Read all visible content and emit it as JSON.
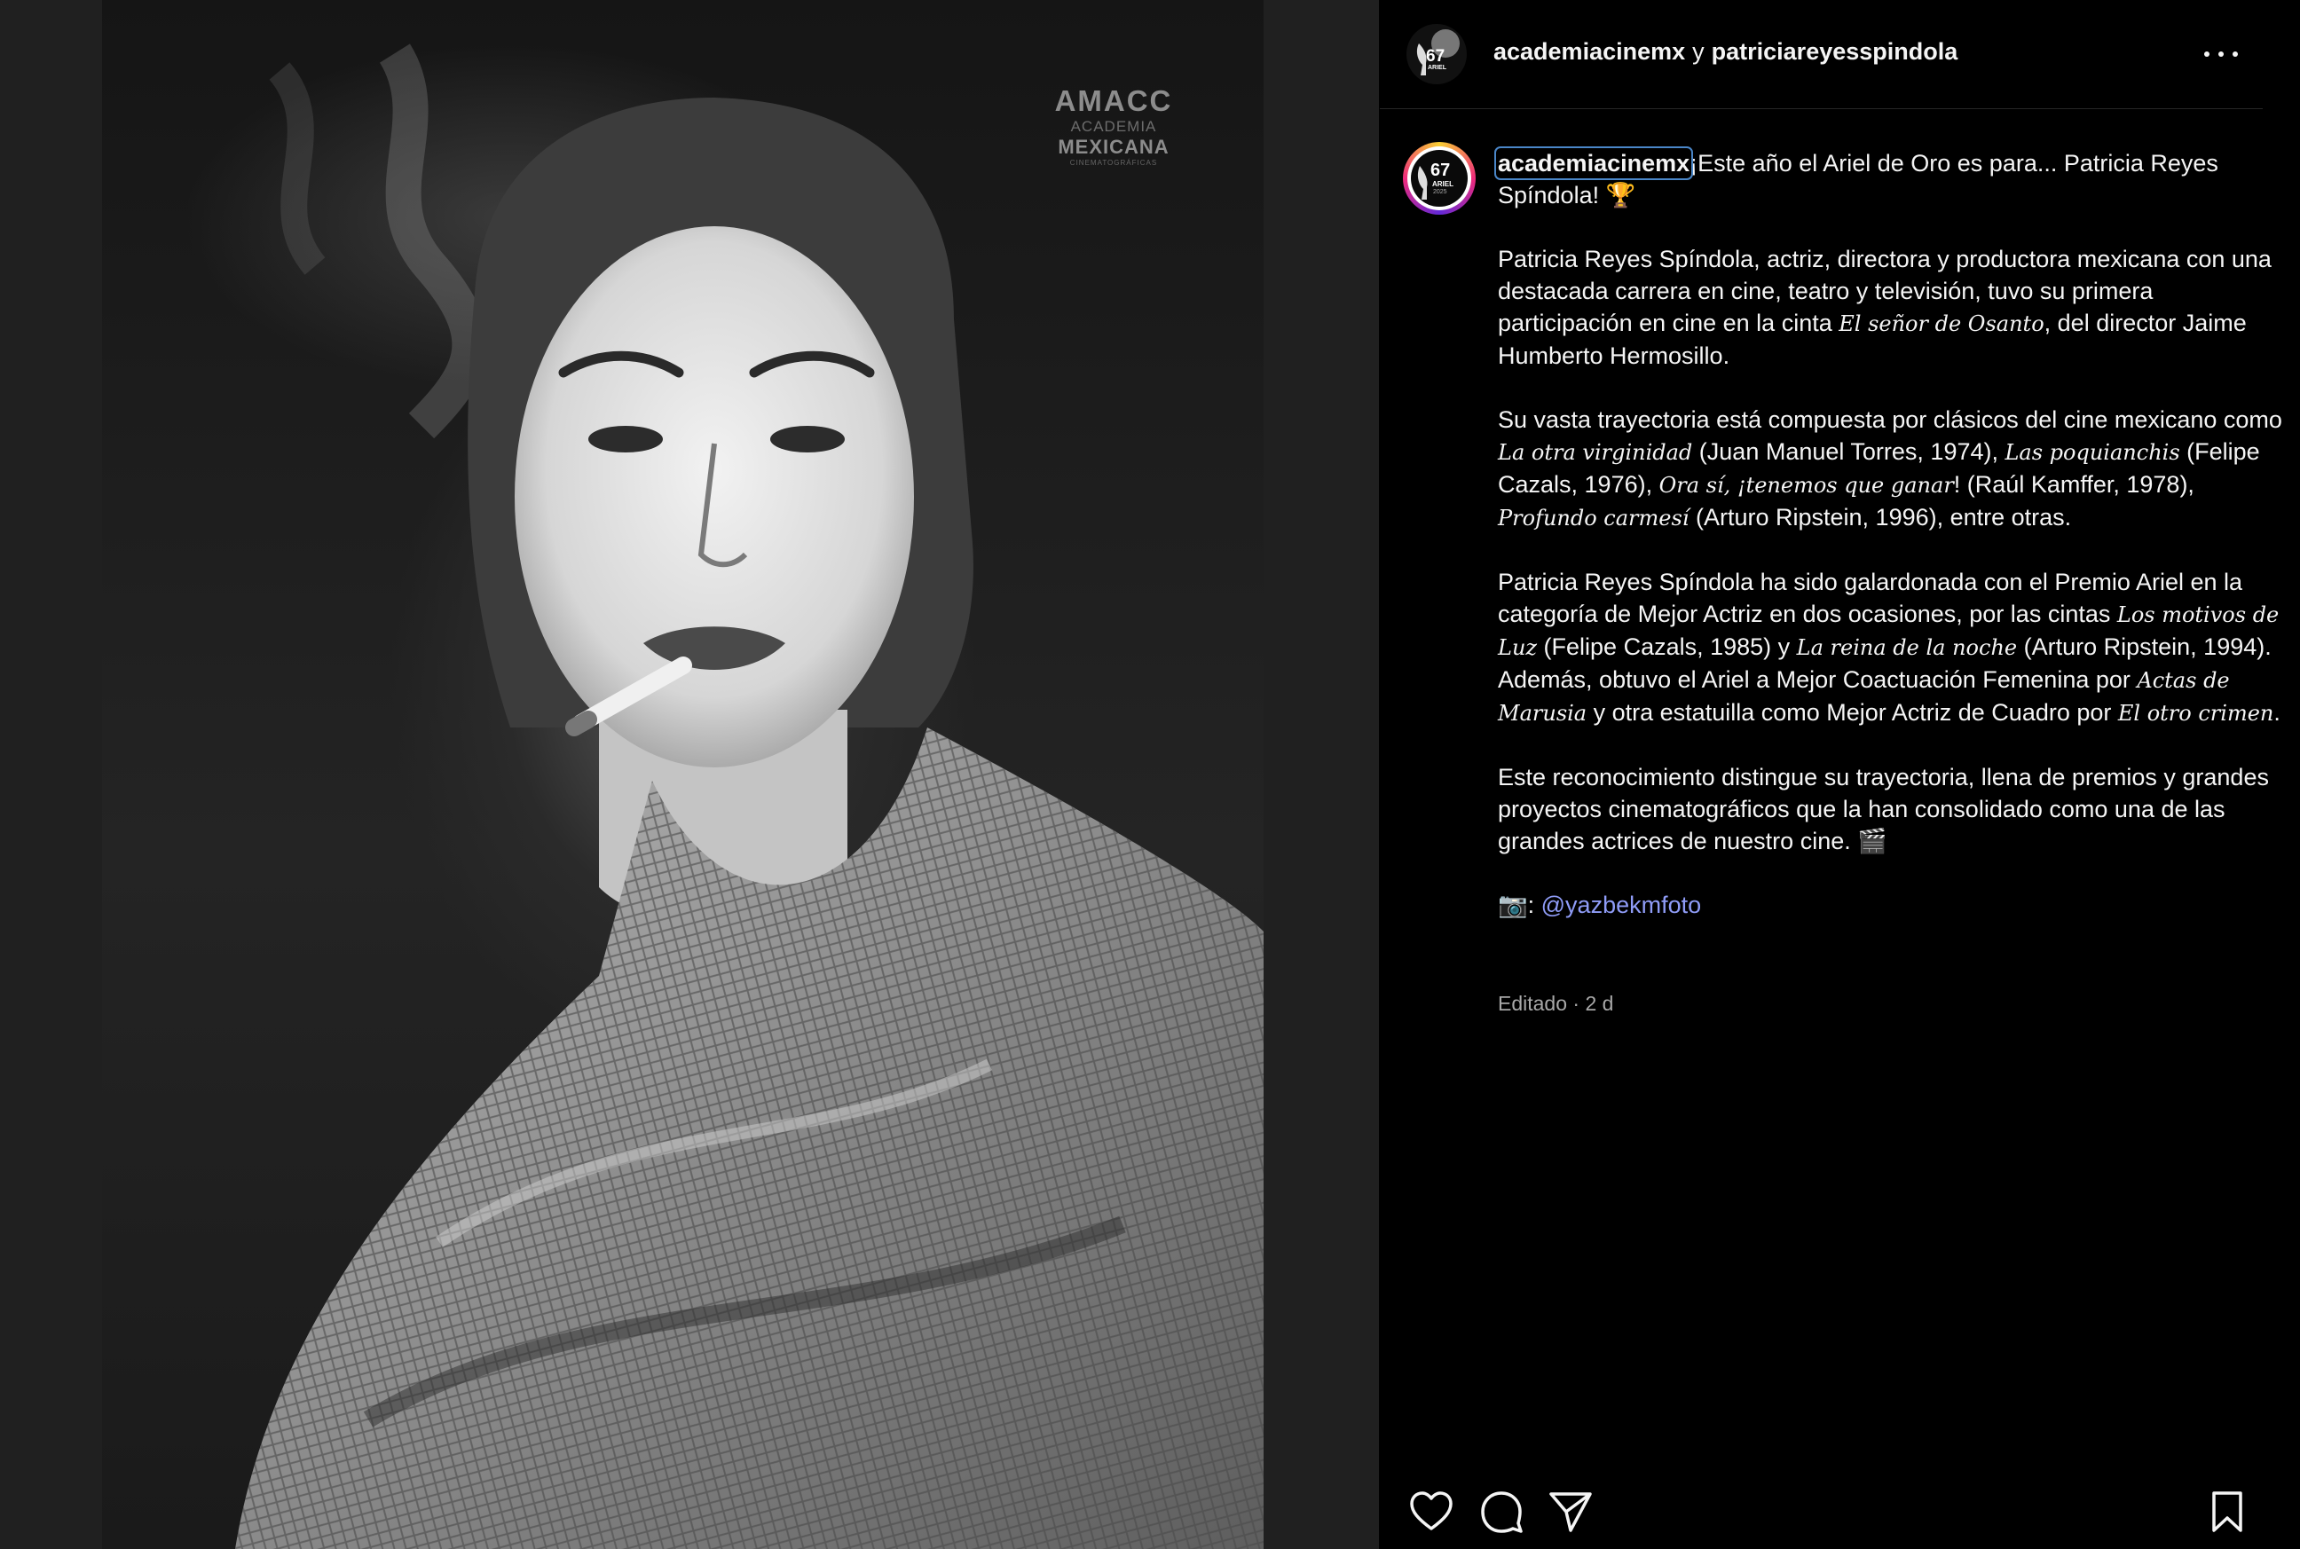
{
  "photo": {
    "logo": {
      "line1": "AMACC",
      "line2": "ACADEMIA",
      "line3": "MEXICANA",
      "line4": "CINEMATOGRÁFICAS"
    }
  },
  "header": {
    "author": "academiacinemx",
    "connector": "y",
    "coauthor": "patriciareyesspindola",
    "avatar_badge": "67",
    "avatar_badge_sub": "ARIEL"
  },
  "caption": {
    "username": "academiacinemx",
    "avatar_badge": "67",
    "avatar_badge_sub": "ARIEL",
    "avatar_badge_year": "2025",
    "intro": "¡Este año el Ariel de Oro es para... Patricia Reyes Spíndola! 🏆",
    "p1_a": "Patricia Reyes Spíndola, actriz, directora y productora mexicana con una destacada carrera en cine, teatro y televisión, tuvo su primera participación en cine en la cinta ",
    "p1_film": "El señor de Osanto",
    "p1_b": ", del director Jaime Humberto Hermosillo.",
    "p2_a": "Su vasta trayectoria está compuesta por clásicos del cine mexicano como ",
    "p2_f1": "La otra virginidad",
    "p2_b": " (Juan Manuel Torres, 1974), ",
    "p2_f2": "Las poquianchis",
    "p2_c": " (Felipe Cazals, 1976), ",
    "p2_f3": "Ora sí, ¡tenemos que ganar",
    "p2_d": "! (Raúl Kamffer, 1978), ",
    "p2_f4": "Profundo carmesí",
    "p2_e": " (Arturo Ripstein, 1996), entre otras.",
    "p3_a": "Patricia Reyes Spíndola ha sido galardonada con el Premio Ariel en la categoría de Mejor Actriz en dos ocasiones, por las cintas ",
    "p3_f1": "Los motivos de Luz",
    "p3_b": " (Felipe Cazals, 1985) y ",
    "p3_f2": "La reina de la noche",
    "p3_c": " (Arturo Ripstein, 1994). Además, obtuvo el Ariel a Mejor Coactuación Femenina por ",
    "p3_f3": "Actas de Marusia",
    "p3_d": " y otra estatuilla como Mejor Actriz de Cuadro por ",
    "p3_f4": "El otro crimen",
    "p3_e": ".",
    "p4": "Este reconocimiento distingue su trayectoria, llena de premios y grandes proyectos cinematográficos que la han consolidado como una de las grandes actrices de nuestro cine. 🎬",
    "credit_emoji": "📷:",
    "credit_handle": "@yazbekmfoto",
    "meta": "Editado · 2 d"
  },
  "actions": {
    "like": "heart-icon",
    "comment": "comment-icon",
    "share": "paper-plane-icon",
    "save": "bookmark-icon"
  },
  "colors": {
    "background": "#000000",
    "text": "#f5f5f5",
    "link": "#8f9cf7",
    "meta": "#a8a8a8",
    "mention_outline": "#4a86c8"
  }
}
